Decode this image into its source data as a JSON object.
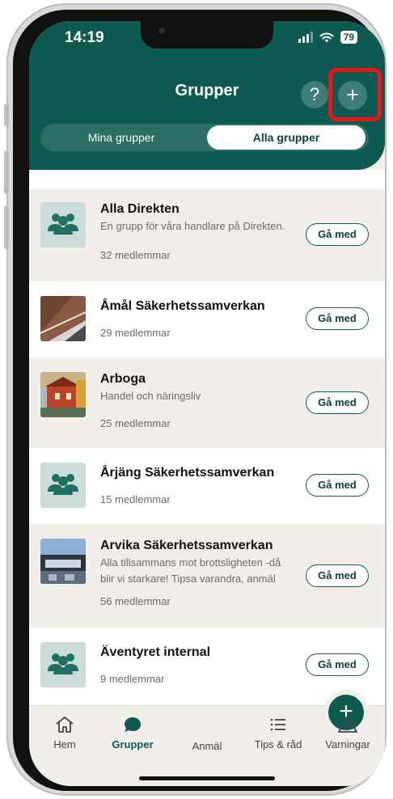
{
  "status": {
    "time": "14:19",
    "battery": "79"
  },
  "header": {
    "title": "Grupper",
    "help_label": "?",
    "add_label": "+"
  },
  "tabs_toggle": {
    "mine": "Mina grupper",
    "all": "Alla grupper"
  },
  "join_label": "Gå med",
  "groups": [
    {
      "title": "Alla Direkten",
      "desc": "En grupp för våra handlare på Direkten.",
      "members": "32 medlemmar"
    },
    {
      "title": "Åmål Säkerhetssamverkan",
      "desc": "",
      "members": "29 medlemmar"
    },
    {
      "title": "Arboga",
      "desc": "Handel och näringsliv",
      "members": "25 medlemmar"
    },
    {
      "title": "Årjäng Säkerhetssamverkan",
      "desc": "",
      "members": "15 medlemmar"
    },
    {
      "title": "Arvika Säkerhetssamverkan",
      "desc": "Alla tillsammans mot brottsligheten -då blir vi starkare! Tipsa varandra, anmäl",
      "members": "56 medlemmar"
    },
    {
      "title": "Äventyret internal",
      "desc": "",
      "members": "9 medlemmar"
    }
  ],
  "tabbar": {
    "home": "Hem",
    "groups": "Grupper",
    "report": "Anmäl",
    "tips": "Tips & råd",
    "warnings": "Varningar",
    "fab_label": "+"
  },
  "colors": {
    "brand": "#0e5a52",
    "highlight": "#e8161b",
    "background": "#f2eeea"
  }
}
